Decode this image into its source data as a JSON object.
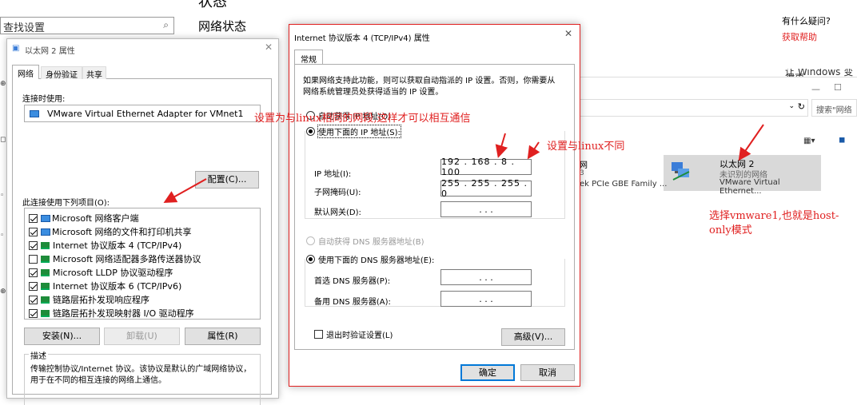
{
  "background": {
    "search_placeholder": "查找设置",
    "status_heading": "状态",
    "network_status": "网络状态",
    "help_question": "有什么疑问?",
    "help_link": "获取帮助",
    "explorer_search": "搜索\"网络",
    "adapter_name": "以太网 2",
    "adapter_status": "未识别的网络",
    "adapter_device": "VMware Virtual Ethernet...",
    "other_adapter_device": "ek PCIe GBE Family ...",
    "truncated_note": "让 Windows 变得更"
  },
  "props_dialog": {
    "title": "以太网 2 属性",
    "tabs": [
      "网络",
      "身份验证",
      "共享"
    ],
    "connect_using_label": "连接时使用:",
    "adapter": "VMware Virtual Ethernet Adapter for VMnet1",
    "configure_button": "配置(C)...",
    "items_label": "此连接使用下列项目(O):",
    "items": [
      {
        "label": "Microsoft 网络客户端",
        "checked": true,
        "icon": "network-client-icon"
      },
      {
        "label": "Microsoft 网络的文件和打印机共享",
        "checked": true,
        "icon": "network-client-icon"
      },
      {
        "label": "Internet 协议版本 4 (TCP/IPv4)",
        "checked": true,
        "icon": "protocol-icon"
      },
      {
        "label": "Microsoft 网络适配器多路传送器协议",
        "checked": false,
        "icon": "protocol-icon"
      },
      {
        "label": "Microsoft LLDP 协议驱动程序",
        "checked": true,
        "icon": "protocol-icon"
      },
      {
        "label": "Internet 协议版本 6 (TCP/IPv6)",
        "checked": true,
        "icon": "protocol-icon"
      },
      {
        "label": "链路层拓扑发现响应程序",
        "checked": true,
        "icon": "protocol-icon"
      },
      {
        "label": "链路层拓扑发现映射器 I/O 驱动程序",
        "checked": true,
        "icon": "protocol-icon"
      }
    ],
    "install_button": "安装(N)...",
    "uninstall_button": "卸载(U)",
    "properties_button": "属性(R)",
    "description_label": "描述",
    "description_text": "传输控制协议/Internet 协议。该协议是默认的广域网络协议，用于在不同的相互连接的网络上通信。"
  },
  "ipv4_dialog": {
    "title": "Internet 协议版本 4 (TCP/IPv4) 属性",
    "tab": "常规",
    "intro": "如果网络支持此功能，则可以获取自动指派的 IP 设置。否则，你需要从网络系统管理员处获得适当的 IP 设置。",
    "auto_ip": "自动获得 IP 地址(O)",
    "manual_ip": "使用下面的 IP 地址(S):",
    "ip_label": "IP 地址(I):",
    "ip_value": "192 . 168 .  8  . 100",
    "mask_label": "子网掩码(U):",
    "mask_value": "255 . 255 . 255 .  0",
    "gateway_label": "默认网关(D):",
    "gateway_value": ".       .       .",
    "auto_dns": "自动获得 DNS 服务器地址(B)",
    "manual_dns": "使用下面的 DNS 服务器地址(E):",
    "dns1_label": "首选 DNS 服务器(P):",
    "dns1_value": ".       .       .",
    "dns2_label": "备用 DNS 服务器(A):",
    "dns2_value": ".       .       .",
    "validate_label": "退出时验证设置(L)",
    "advanced_button": "高级(V)...",
    "ok_button": "确定",
    "cancel_button": "取消"
  },
  "annotations": {
    "same_segment": "设置为与linux相同的网段,这样才可以相互通信",
    "different": "设置与linux不同",
    "choose_vmware": "选择vmware1,也就是host-only模式"
  },
  "colors": {
    "annotation": "#e02020",
    "link": "#e02020",
    "accent": "#0078d7"
  }
}
